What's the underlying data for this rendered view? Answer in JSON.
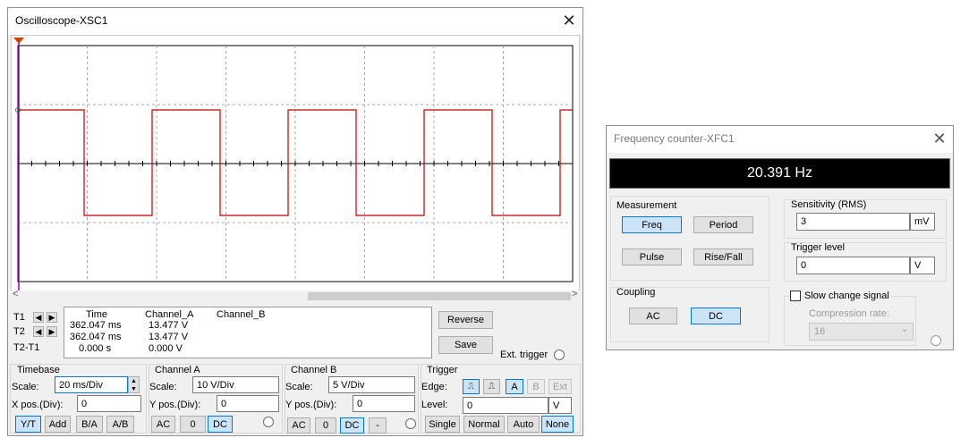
{
  "oscilloscope": {
    "title": "Oscilloscope-XSC1",
    "readout": {
      "headers": [
        "Time",
        "Channel_A",
        "Channel_B"
      ],
      "rows": [
        {
          "label": "T1",
          "time": "362.047 ms",
          "ch_a": "13.477 V",
          "ch_b": ""
        },
        {
          "label": "T2",
          "time": "362.047 ms",
          "ch_a": "13.477 V",
          "ch_b": ""
        },
        {
          "label": "T2-T1",
          "time": "0.000 s",
          "ch_a": "0.000 V",
          "ch_b": ""
        }
      ]
    },
    "reverse_label": "Reverse",
    "save_label": "Save",
    "ext_trigger_label": "Ext. trigger",
    "timebase": {
      "title": "Timebase",
      "scale_label": "Scale:",
      "scale_value": "20 ms/Div",
      "xpos_label": "X pos.(Div):",
      "xpos_value": "0",
      "modes": [
        "Y/T",
        "Add",
        "B/A",
        "A/B"
      ]
    },
    "channel_a": {
      "title": "Channel A",
      "scale_label": "Scale:",
      "scale_value": "10  V/Div",
      "ypos_label": "Y pos.(Div):",
      "ypos_value": "0",
      "couplings": [
        "AC",
        "0",
        "DC"
      ]
    },
    "channel_b": {
      "title": "Channel B",
      "scale_label": "Scale:",
      "scale_value": "5  V/Div",
      "ypos_label": "Y pos.(Div):",
      "ypos_value": "0",
      "couplings": [
        "AC",
        "0",
        "DC",
        "-"
      ]
    },
    "trigger": {
      "title": "Trigger",
      "edge_label": "Edge:",
      "sources": [
        "A",
        "B",
        "Ext"
      ],
      "level_label": "Level:",
      "level_value": "0",
      "level_unit": "V",
      "modes": [
        "Single",
        "Normal",
        "Auto",
        "None"
      ]
    },
    "trace_color": "#c00000",
    "cursor_color": "#a000c0"
  },
  "frequency_counter": {
    "title": "Frequency counter-XFC1",
    "display": "20.391 Hz",
    "measurement_label": "Measurement",
    "measurements": [
      "Freq",
      "Period",
      "Pulse",
      "Rise/Fall"
    ],
    "coupling_label": "Coupling",
    "couplings": [
      "AC",
      "DC"
    ],
    "sensitivity_label": "Sensitivity (RMS)",
    "sensitivity_value": "3",
    "sensitivity_unit": "mV",
    "trigger_level_label": "Trigger level",
    "trigger_level_value": "0",
    "trigger_level_unit": "V",
    "slow_change_label": "Slow change signal",
    "compression_label": "Compression rate:",
    "compression_value": "16"
  }
}
